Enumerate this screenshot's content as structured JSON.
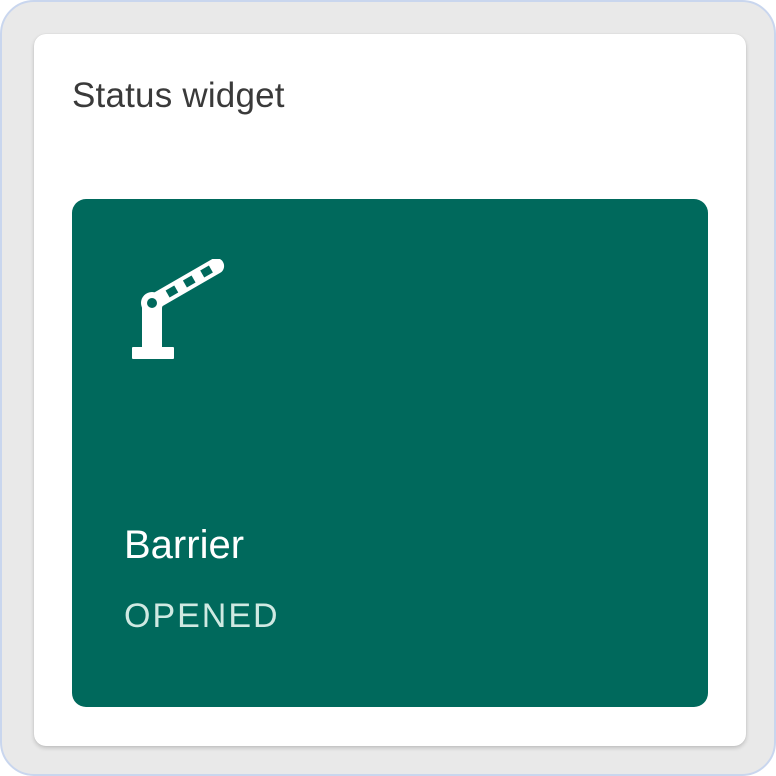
{
  "widget": {
    "title": "Status widget"
  },
  "tile": {
    "name": "Barrier",
    "state": "OPENED",
    "icon": "barrier-gate-icon",
    "color": "#00695c"
  }
}
